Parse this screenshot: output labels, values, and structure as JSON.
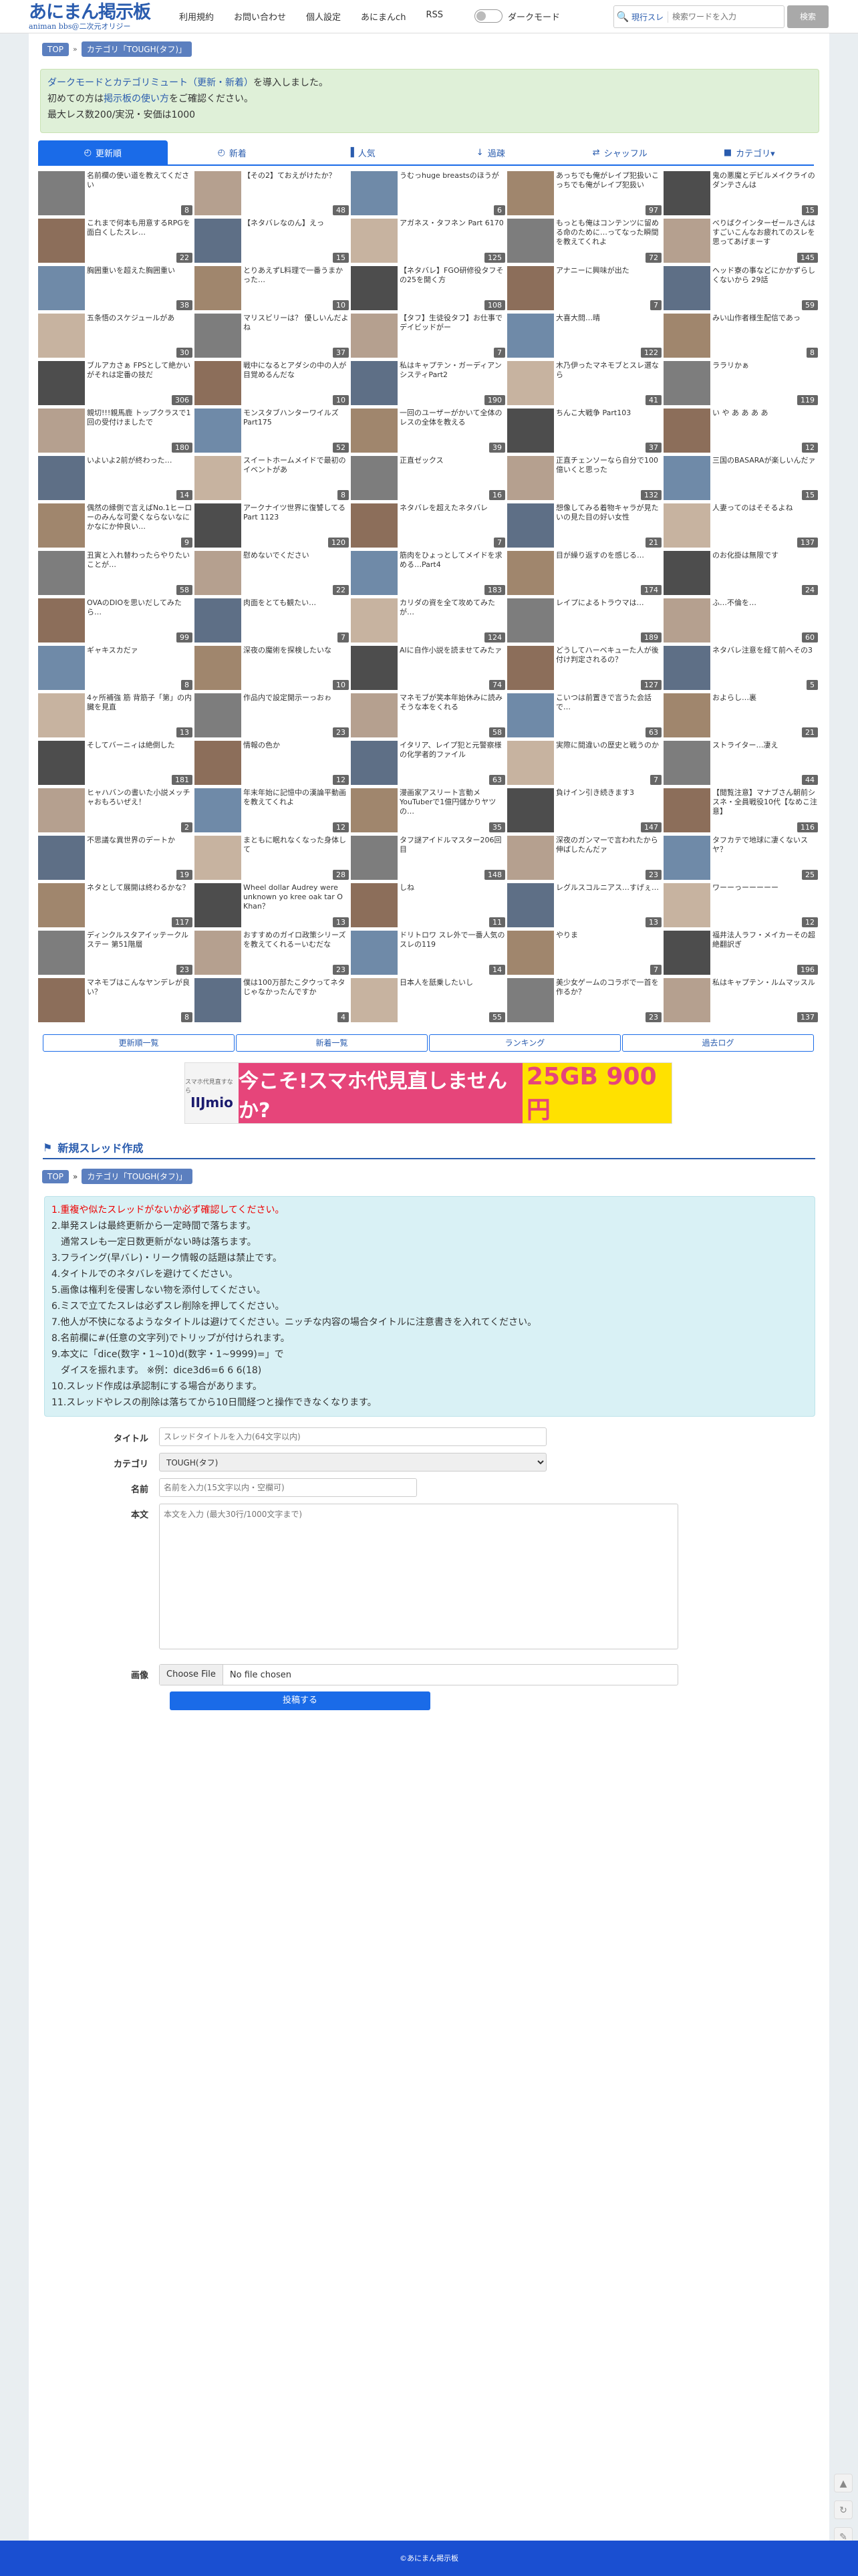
{
  "header": {
    "logo_main": "あにまん掲示板",
    "logo_sub": "animan bbs@二次元オリジー",
    "nav": [
      "利用規約",
      "お問い合わせ",
      "個人設定",
      "あにまんch",
      "RSS"
    ],
    "dark_mode_label": "ダークモード",
    "search_scope": "現行スレ",
    "search_placeholder": "検索ワードを入力",
    "search_button": "検索"
  },
  "breadcrumb": {
    "top": "TOP",
    "sep": "»",
    "category": "カテゴリ「TOUGH(タフ)」"
  },
  "notice": {
    "line1_link": "ダークモードとカテゴリミュート（更新・新着）",
    "line1_rest": "を導入しました。",
    "line2_pre": "初めての方は",
    "line2_link": "掲示板の使い方",
    "line2_post": "をご確認ください。",
    "line3": "最大レス数200/実況・安価は1000"
  },
  "tabs": [
    {
      "label": "更新順",
      "icon": "clock"
    },
    {
      "label": "新着",
      "icon": "clock"
    },
    {
      "label": "人気",
      "icon": "bar"
    },
    {
      "label": "過疎",
      "icon": "down"
    },
    {
      "label": "シャッフル",
      "icon": "shuffle"
    },
    {
      "label": "カテゴリ▾",
      "icon": "folder"
    }
  ],
  "threads": [
    {
      "t": "名前欄の使い道を教えてください",
      "c": "8"
    },
    {
      "t": "【その2】ておえがけたか？",
      "c": "48"
    },
    {
      "t": "うむっhuge breastsのほうが",
      "c": "6"
    },
    {
      "t": "あっちでも俺がレイプ犯扱いこっちでも俺がレイプ犯扱い",
      "c": "97"
    },
    {
      "t": "鬼の悪魔とデビルメイクライのダンテさんは",
      "c": "15"
    },
    {
      "t": "これまで何本も用意するRPGを面白くしたスレ…",
      "c": "22"
    },
    {
      "t": "【ネタバレなのん】えっ",
      "c": "15"
    },
    {
      "t": "アガネス・タフネン Part 6170",
      "c": "125"
    },
    {
      "t": "もっとも俺はコンテンツに留める命のために…ってなった瞬間を教えてくれよ",
      "c": "72"
    },
    {
      "t": "べりばクインターゼールさんはすごいこんなお疲れてのスレを思ってあげまーす",
      "c": "145"
    },
    {
      "t": "胸囲重いを超えた胸囲重い",
      "c": "38"
    },
    {
      "t": "とりあえずL料理で一番うまかった…",
      "c": "10"
    },
    {
      "t": "【ネタバレ】FGO研修役タフその25を開く方",
      "c": "108"
    },
    {
      "t": "アナニーに興味が出た",
      "c": "7"
    },
    {
      "t": "ヘッド寮の事などにかかずらしくないから 29話",
      "c": "59"
    },
    {
      "t": "五条悟のスケジュールがあ",
      "c": "30"
    },
    {
      "t": "マリスビリーは？ 優しいんだよね",
      "c": "37"
    },
    {
      "t": "【タフ】生徒役タフ】お仕事でデイビッドがー",
      "c": "7"
    },
    {
      "t": "大喜大問…晴",
      "c": "122"
    },
    {
      "t": "みい山作者様生配信であっ",
      "c": "8"
    },
    {
      "t": "ブルアカさぁ FPSとして絶かいがそれは定番の技だ",
      "c": "306"
    },
    {
      "t": "戦中になるとアダシの中の人が目覚めるんだな",
      "c": "10"
    },
    {
      "t": "私はキャプテン・ガーディアンシスティPart2",
      "c": "190"
    },
    {
      "t": "木乃伊ったマネモブとスレ選なら",
      "c": "41"
    },
    {
      "t": "ララリかぁ",
      "c": "119"
    },
    {
      "t": "親切!!!親馬鹿 トップクラスで1回の受付けましたで",
      "c": "180"
    },
    {
      "t": "モンスタブハンターワイルズPart175",
      "c": "52"
    },
    {
      "t": "一回のユーザーがかいて全体のレスの全体を教える",
      "c": "39"
    },
    {
      "t": "ちんこ大戦争 Part103",
      "c": "37"
    },
    {
      "t": "い や あ あ あ あ",
      "c": "12"
    },
    {
      "t": "いよいよ2前が終わった…",
      "c": "14"
    },
    {
      "t": "スイートホームメイドで最初のイベントがあ",
      "c": "8"
    },
    {
      "t": "正直ゼックス",
      "c": "16"
    },
    {
      "t": "正直チェンソーなら自分で100億いくと思った",
      "c": "132"
    },
    {
      "t": "三国のBASARAが楽しいんだァ",
      "c": "15"
    },
    {
      "t": "偶然の縁側で言えばNo.1ヒーローのみんな可愛くならないなにかなにか仲良い…",
      "c": "9"
    },
    {
      "t": "アークナイツ世界に復讐してるPart 1123",
      "c": "120"
    },
    {
      "t": "ネタバレを超えたネタバレ",
      "c": "7"
    },
    {
      "t": "想像してみる着物キャラが見たいの見た目の好い女性",
      "c": "21"
    },
    {
      "t": "人妻ってのはそそるよね",
      "c": "137"
    },
    {
      "t": "丑寅と入れ替わったらやりたいことが…",
      "c": "58"
    },
    {
      "t": "慰めないでください",
      "c": "22"
    },
    {
      "t": "筋肉をひょっとしてメイドを求める…Part4",
      "c": "183"
    },
    {
      "t": "目が繰り返すのを感じる…",
      "c": "174"
    },
    {
      "t": "のお化掛は無限です",
      "c": "24"
    },
    {
      "t": "OVAのDIOを思いだしてみたら…",
      "c": "99"
    },
    {
      "t": "肉面をとても観たい…",
      "c": "7"
    },
    {
      "t": "カリダの資を全て攻めてみたが…",
      "c": "124"
    },
    {
      "t": "レイプによるトラウマは…",
      "c": "189"
    },
    {
      "t": "ふ…不倫を…",
      "c": "60"
    },
    {
      "t": "ギャキスカだァ",
      "c": "8"
    },
    {
      "t": "深夜の魔術を探検したいな",
      "c": "10"
    },
    {
      "t": "Alに自作小説を読ませてみたァ",
      "c": "74"
    },
    {
      "t": "どうしてハーベキューた人が後付け判定されるの？",
      "c": "127"
    },
    {
      "t": "ネタバレ注意を経て前へその3",
      "c": "5"
    },
    {
      "t": "4ヶ所補強 筋 背筋子「第」の内臓を見直",
      "c": "13"
    },
    {
      "t": "作品内で設定開示ーっおゎ",
      "c": "23"
    },
    {
      "t": "マネモブが笑本年始休みに読みそうな本をくれる",
      "c": "58"
    },
    {
      "t": "こいつは前置きで言うた会話で…",
      "c": "63"
    },
    {
      "t": "およらし…裏",
      "c": "21"
    },
    {
      "t": "そしてバーニィは絶倒した",
      "c": "181"
    },
    {
      "t": "情報の色か",
      "c": "12"
    },
    {
      "t": "イタリア、レイプ犯と元警察様の化学者的ファイル",
      "c": "63"
    },
    {
      "t": "実際に間違いの歴史と戦うのか",
      "c": "7"
    },
    {
      "t": "ストライター…凄え",
      "c": "44"
    },
    {
      "t": "ヒャハバンの書いた小説メッチャおもろいぜえ！",
      "c": "2"
    },
    {
      "t": "年末年始に記憶中の漢論平動画を教えてくれよ",
      "c": "12"
    },
    {
      "t": "漫画家アスリート言動メYouTuberで1億円儲かりヤツの…",
      "c": "35"
    },
    {
      "t": "負けイン引き続きます3",
      "c": "147"
    },
    {
      "t": "【閲覧注意】マナブさん朝前シスネ・全員戦役10代【なめこ注意】",
      "c": "116"
    },
    {
      "t": "不思議な異世界のデートか",
      "c": "19"
    },
    {
      "t": "まともに眠れなくなった身体して",
      "c": "28"
    },
    {
      "t": "タフ謎アイドルマスター206回目",
      "c": "148"
    },
    {
      "t": "深夜のガンマーで言われたから伸ばしたんだァ",
      "c": "23"
    },
    {
      "t": "タフカテで地球に凄くないスヤ？",
      "c": "25"
    },
    {
      "t": "ネタとして展開は終わるかな？",
      "c": "117"
    },
    {
      "t": "Wheel dollar Audrey were unknown yo kree oak tar O Khan？",
      "c": "13"
    },
    {
      "t": "しね",
      "c": "11"
    },
    {
      "t": "レグルスコルニアス…すげぇ…",
      "c": "13"
    },
    {
      "t": "ワーーっーーーーー",
      "c": "12"
    },
    {
      "t": "ディンクルスタアイッテークルステー 第51階層",
      "c": "23"
    },
    {
      "t": "おすすめのガイロ政策シリーズを教えてくれるーいむだな",
      "c": "23"
    },
    {
      "t": "ドリトロワ スレ外で一番人気のスレの119",
      "c": "14"
    },
    {
      "t": "やりま",
      "c": "7"
    },
    {
      "t": "福井法人ラフ・メイカーその超絶翻訳ぎ",
      "c": "196"
    },
    {
      "t": "マネモブはこんなヤンデレが良い？",
      "c": "8"
    },
    {
      "t": "僕は100万部たこ夕ウってネタじゃなかったんですか",
      "c": "4"
    },
    {
      "t": "日本人を舐乗したいし",
      "c": "55"
    },
    {
      "t": "美少女ゲームのコラボで一首を作るか？",
      "c": "23"
    },
    {
      "t": "私はキャプテン・ルムマッスル",
      "c": "137"
    }
  ],
  "bottom_nav": [
    "更新順一覧",
    "新着一覧",
    "ランキング",
    "過去ログ"
  ],
  "ad": {
    "brand_small": "スマホ代見直すなら",
    "brand": "IIJmio",
    "headline": "今こそ!スマホ代見直しませんか?",
    "price": "25GB 900円"
  },
  "new_thread": {
    "heading": "新規スレッド作成"
  },
  "rules": [
    "1.重複や似たスレッドがないか必ず確認してください。",
    "2.単発スレは最終更新から一定時間で落ちます。",
    "　通常スレも一定日数更新がない時は落ちます。",
    "3.フライング(早バレ)・リーク情報の話題は禁止です。",
    "4.タイトルでのネタバレを避けてください。",
    "5.画像は権利を侵害しない物を添付してください。",
    "6.ミスで立てたスレは必ずスレ削除を押してください。",
    "7.他人が不快になるようなタイトルは避けてください。ニッチな内容の場合タイトルに注意書きを入れてください。",
    "8.名前欄に#(任意の文字列)でトリップが付けられます。",
    "9.本文に「dice(数字・1~10)d(数字・1~9999)=」で",
    "　ダイスを振れます。 ※例：dice3d6=6 6 6(18)",
    "10.スレッド作成は承認制にする場合があります。",
    "11.スレッドやレスの削除は落ちてから10日間経つと操作できなくなります。"
  ],
  "form": {
    "title_label": "タイトル",
    "title_placeholder": "スレッドタイトルを入力(64文字以内)",
    "category_label": "カテゴリ",
    "category_value": "TOUGH(タフ)",
    "name_label": "名前",
    "name_placeholder": "名前を入力(15文字以内・空欄可)",
    "body_label": "本文",
    "body_placeholder": "本文を入力 (最大30行/1000文字まで)",
    "image_label": "画像",
    "file_button": "Choose File",
    "file_status": "No file chosen",
    "submit": "投稿する"
  },
  "footer": {
    "text": "©あにまん掲示板"
  }
}
